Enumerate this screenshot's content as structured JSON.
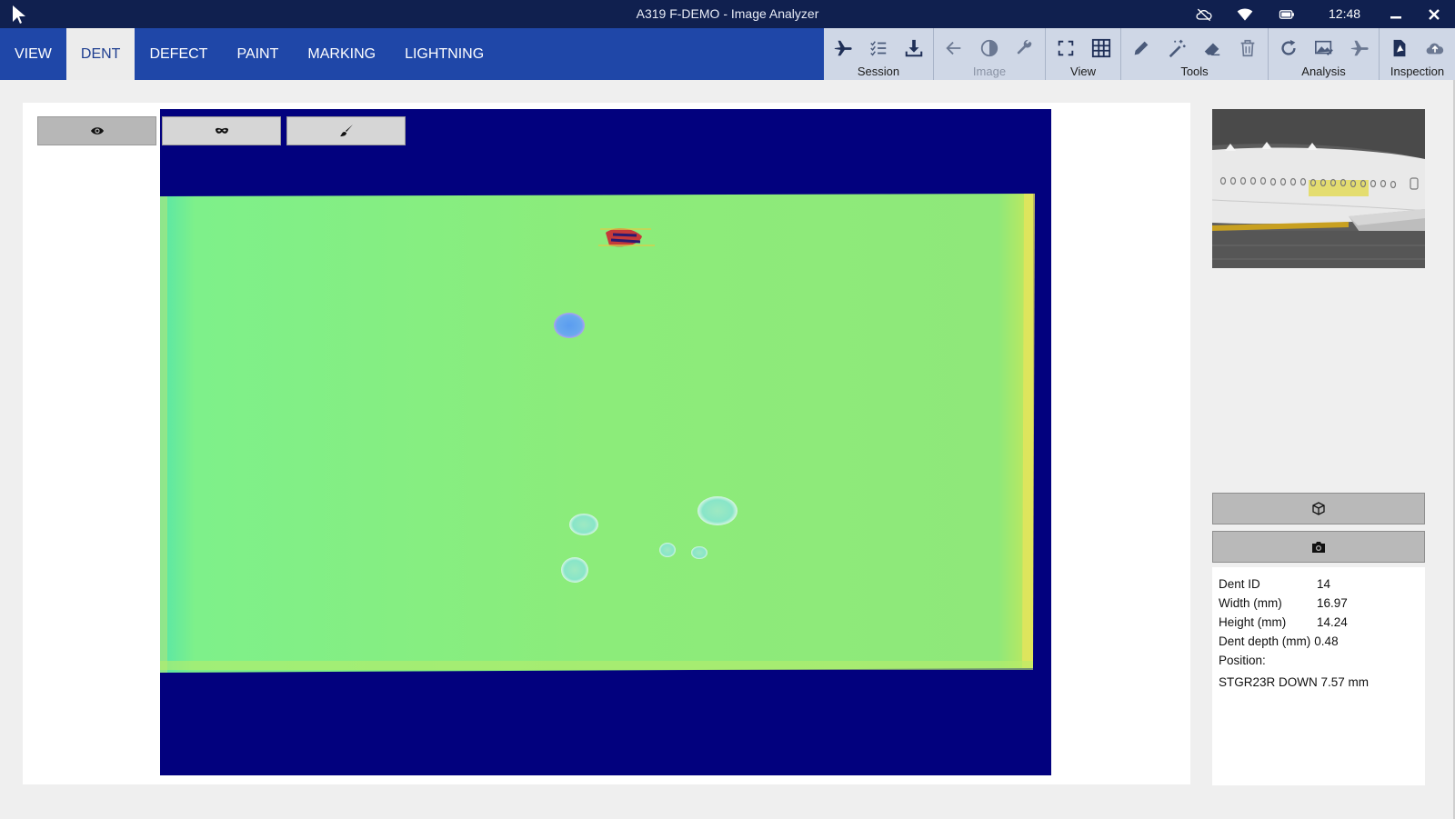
{
  "window": {
    "title": "A319 F-DEMO - Image Analyzer",
    "clock": "12:48"
  },
  "tabs": [
    {
      "label": "VIEW",
      "active": false
    },
    {
      "label": "DENT",
      "active": true
    },
    {
      "label": "DEFECT",
      "active": false
    },
    {
      "label": "PAINT",
      "active": false
    },
    {
      "label": "MARKING",
      "active": false
    },
    {
      "label": "LIGHTNING",
      "active": false
    }
  ],
  "toolbar": {
    "groups": [
      {
        "label": "Session",
        "icons": [
          "plane-icon",
          "checklist-icon",
          "download-icon"
        ],
        "enabled": true
      },
      {
        "label": "Image",
        "icons": [
          "arrow-left-icon",
          "contrast-icon",
          "wrench-icon"
        ],
        "enabled": false
      },
      {
        "label": "View",
        "icons": [
          "fullscreen-icon",
          "grid-icon"
        ],
        "enabled": true
      },
      {
        "label": "Tools",
        "icons": [
          "pencil-icon",
          "magic-wand-icon",
          "eraser-icon",
          "trash-icon"
        ],
        "enabled": true
      },
      {
        "label": "Analysis",
        "icons": [
          "refresh-icon",
          "image-chart-icon",
          "plane-analysis-icon"
        ],
        "enabled": true
      },
      {
        "label": "Inspection",
        "icons": [
          "pdf-icon",
          "cloud-upload-icon"
        ],
        "enabled": true
      }
    ]
  },
  "canvas_modes": [
    {
      "icon": "eye-icon",
      "active": true
    },
    {
      "icon": "mask-icon",
      "active": false
    },
    {
      "icon": "brush-icon",
      "active": false
    }
  ],
  "side_buttons": [
    {
      "icon": "cube-icon"
    },
    {
      "icon": "camera-icon"
    }
  ],
  "dent_info": {
    "id_label": "Dent ID",
    "id_value": "14",
    "width_label": "Width (mm)",
    "width_value": "16.97",
    "height_label": "Height (mm)",
    "height_value": "14.24",
    "depth_label": "Dent depth (mm)",
    "depth_value": "0.48",
    "position_label": "Position:",
    "position_value": "STGR23R DOWN 7.57 mm"
  },
  "colors": {
    "titlebar": "#10204f",
    "ribbon": "#1f47a8",
    "scan_background": "#02017e",
    "scan_surface": "#86ea7f"
  }
}
